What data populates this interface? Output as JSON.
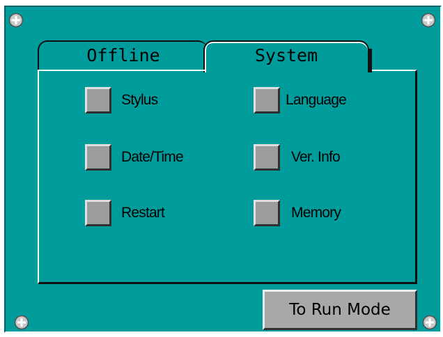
{
  "tabs": {
    "offline": "Offline",
    "system": "System",
    "active": "System"
  },
  "options": {
    "stylus": "Stylus",
    "date_time": "Date/Time",
    "restart": "Restart",
    "language": "Language",
    "ver_info": "Ver. Info",
    "memory": "Memory"
  },
  "run_mode_button": "To Run Mode",
  "colors": {
    "background": "#009c9c",
    "button_face": "#9c9c9c",
    "border_dark": "#101010"
  },
  "icons": {
    "corner_screw": "screw-icon"
  }
}
